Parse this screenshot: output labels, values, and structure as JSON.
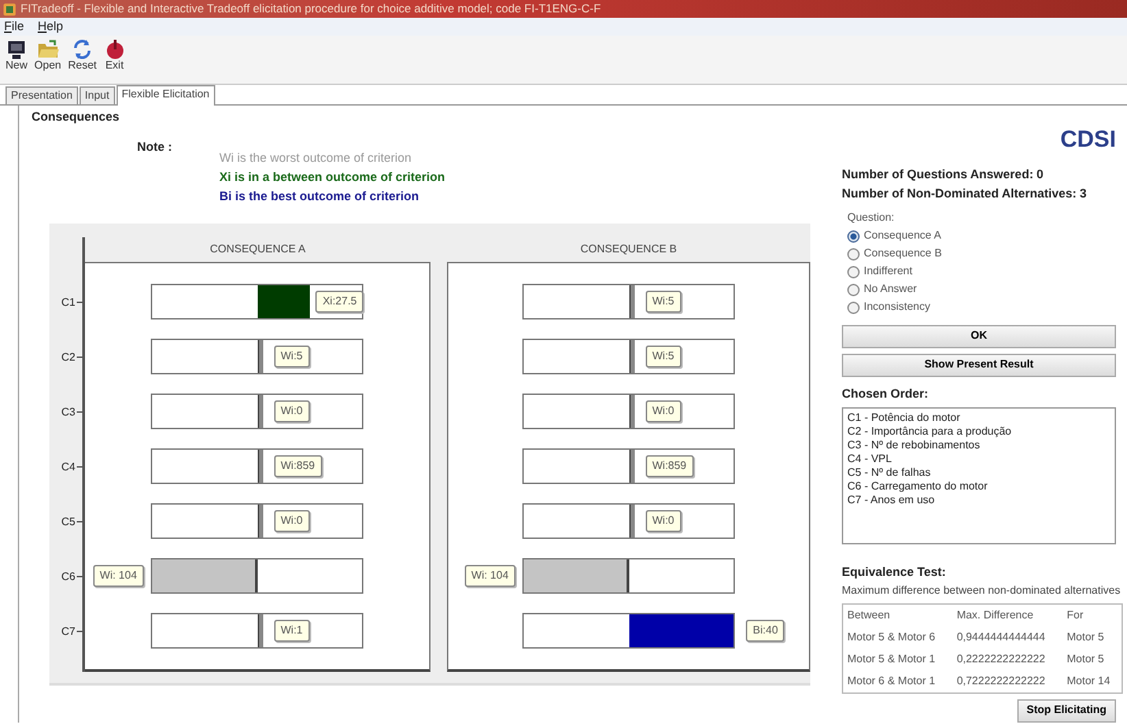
{
  "window": {
    "title": "FITradeoff - Flexible and Interactive Tradeoff elicitation procedure for choice additive model; code FI-T1ENG-C-F"
  },
  "menu": [
    {
      "label": "File"
    },
    {
      "label": "Help"
    }
  ],
  "toolbar": [
    {
      "label": "New",
      "kind": "new"
    },
    {
      "label": "Open",
      "kind": "open"
    },
    {
      "label": "Reset",
      "kind": "reset"
    },
    {
      "label": "Exit",
      "kind": "exit"
    }
  ],
  "tabs": [
    {
      "label": "Presentation",
      "selected": false
    },
    {
      "label": "Input",
      "selected": false
    },
    {
      "label": "Flexible Elicitation",
      "selected": true
    }
  ],
  "consequences": {
    "heading": "Consequences",
    "note_label": "Note :",
    "notes": [
      {
        "text": "Wi is the worst outcome of criterion",
        "kind": "worst"
      },
      {
        "text": "Xi is in a between outcome of criterion",
        "kind": "between"
      },
      {
        "text": "Bi is the best outcome of criterion",
        "kind": "best"
      }
    ],
    "criteria": [
      "C1",
      "C2",
      "C3",
      "C4",
      "C5",
      "C6",
      "C7"
    ],
    "panels": [
      {
        "title": "CONSEQUENCE A",
        "bars": [
          {
            "kind": "between",
            "label": "Xi:27.5"
          },
          {
            "kind": "worst",
            "label": "Wi:5"
          },
          {
            "kind": "worst",
            "label": "Wi:0"
          },
          {
            "kind": "worst",
            "label": "Wi:859"
          },
          {
            "kind": "worst",
            "label": "Wi:0"
          },
          {
            "kind": "reference",
            "label": "Wi: 104"
          },
          {
            "kind": "worst",
            "label": "Wi:1"
          }
        ]
      },
      {
        "title": "CONSEQUENCE B",
        "bars": [
          {
            "kind": "worst",
            "label": "Wi:5"
          },
          {
            "kind": "worst",
            "label": "Wi:5"
          },
          {
            "kind": "worst",
            "label": "Wi:0"
          },
          {
            "kind": "worst",
            "label": "Wi:859"
          },
          {
            "kind": "worst",
            "label": "Wi:0"
          },
          {
            "kind": "reference",
            "label": "Wi: 104"
          },
          {
            "kind": "best",
            "label": "Bi:40"
          }
        ]
      }
    ]
  },
  "logo": "CDSI",
  "stats": [
    {
      "label": "Number of Questions Answered:",
      "value": "0"
    },
    {
      "label": "Number of Non-Dominated Alternatives:",
      "value": "3"
    }
  ],
  "question": {
    "label": "Question:",
    "options": [
      {
        "label": "Consequence A",
        "selected": true
      },
      {
        "label": "Consequence B",
        "selected": false
      },
      {
        "label": "Indifferent",
        "selected": false
      },
      {
        "label": "No Answer",
        "selected": false
      },
      {
        "label": "Inconsistency",
        "selected": false
      }
    ]
  },
  "buttons": [
    "OK",
    "Show Present Result"
  ],
  "chosen_order": {
    "heading": "Chosen Order:",
    "items": [
      "C1 - Potência do motor",
      "C2 - Importância para a produção",
      "C3 - Nº de rebobinamentos",
      "C4 - VPL",
      "C5 - Nº de falhas",
      "C6 - Carregamento do motor",
      "C7 - Anos em uso"
    ]
  },
  "equivalence": {
    "heading": "Equivalence Test:",
    "description": "Maximum difference between non-dominated alternatives",
    "columns": [
      "Between",
      "Max. Difference",
      "For"
    ],
    "rows": [
      [
        "Motor 5 & Motor 6",
        "0,9444444444444",
        "Motor 5"
      ],
      [
        "Motor 5 & Motor 1",
        "0,2222222222222",
        "Motor 5"
      ],
      [
        "Motor 6 & Motor 1",
        "0,7222222222222",
        "Motor 14"
      ]
    ]
  },
  "stop_button": "Stop Elicitating"
}
